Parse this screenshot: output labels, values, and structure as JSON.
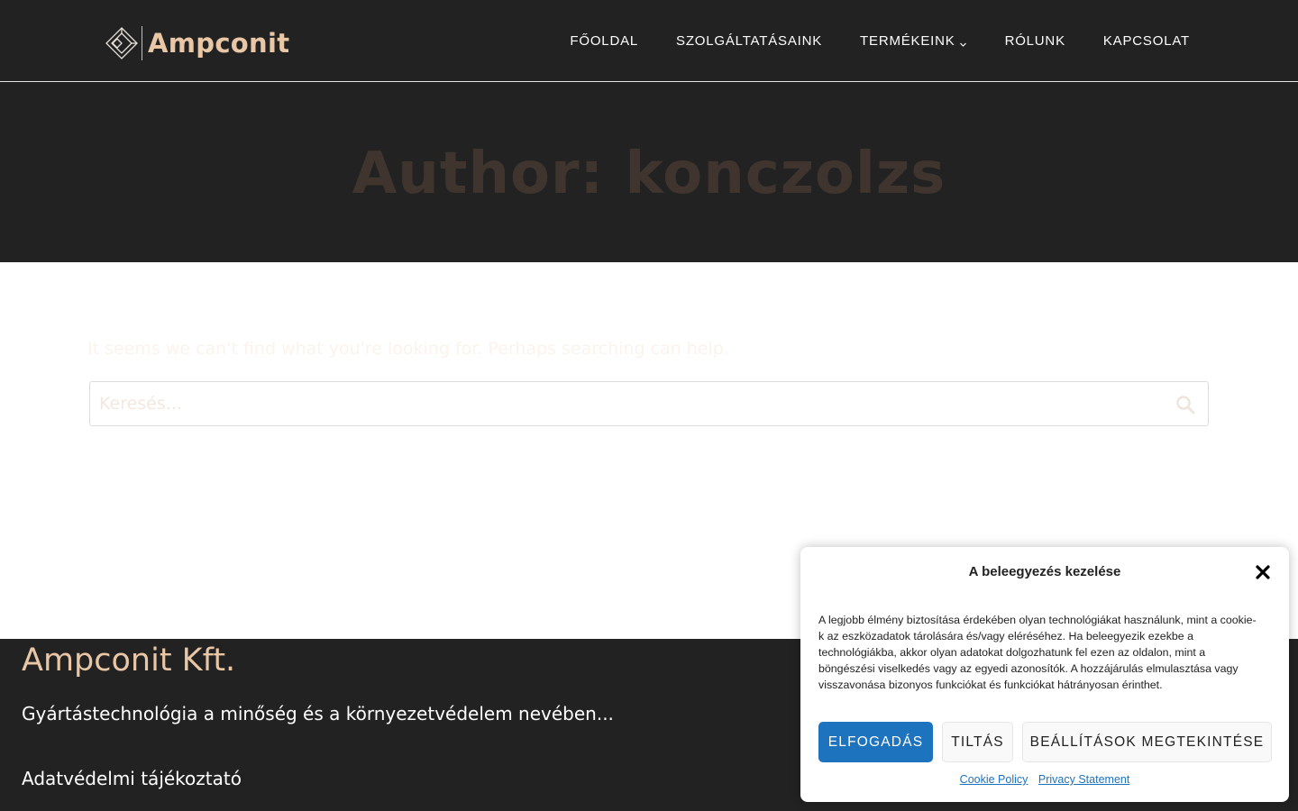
{
  "header": {
    "logo_text": "Ampconit",
    "nav": [
      {
        "label": "FŐOLDAL"
      },
      {
        "label": "SZOLGÁLTATÁSAINK"
      },
      {
        "label": "TERMÉKEINK",
        "has_dropdown": true
      },
      {
        "label": "RÓLUNK"
      },
      {
        "label": "KAPCSOLAT"
      }
    ]
  },
  "hero": {
    "title": "Author: konczolzs"
  },
  "content": {
    "no_results_text": "It seems we can't find what you're looking for. Perhaps searching can help.",
    "search": {
      "placeholder": "Keresés...",
      "value": ""
    }
  },
  "footer": {
    "title": "Ampconit Kft.",
    "tagline": "Gyártástechnológia a minőség és a környezetvédelem nevében...",
    "link": "Adatvédelmi tájékoztató"
  },
  "consent": {
    "title": "A beleegyezés kezelése",
    "body": "A legjobb élmény biztosítása érdekében olyan technológiákat használunk, mint a cookie-k az eszközadatok tárolására és/vagy eléréséhez. Ha beleegyezik ezekbe a technológiákba, akkor olyan adatokat dolgozhatunk fel ezen az oldalon, mint a böngészési viselkedés vagy az egyedi azonosítók. A hozzájárulás elmulasztása vagy visszavonása bizonyos funkciókat és funkciókat hátrányosan érinthet.",
    "accept_label": "ELFOGADÁS",
    "deny_label": "TILTÁS",
    "prefs_label": "BEÁLLÍTÁSOK MEGTEKINTÉSE",
    "links": [
      "Cookie Policy",
      "Privacy Statement"
    ]
  },
  "colors": {
    "dark_bg": "#222222",
    "brand_gold": "#e8c6a6",
    "accent_blue": "#1e73be"
  },
  "icons": [
    "logo-diamond-icon",
    "chevron-down-icon",
    "search-icon",
    "close-icon"
  ]
}
